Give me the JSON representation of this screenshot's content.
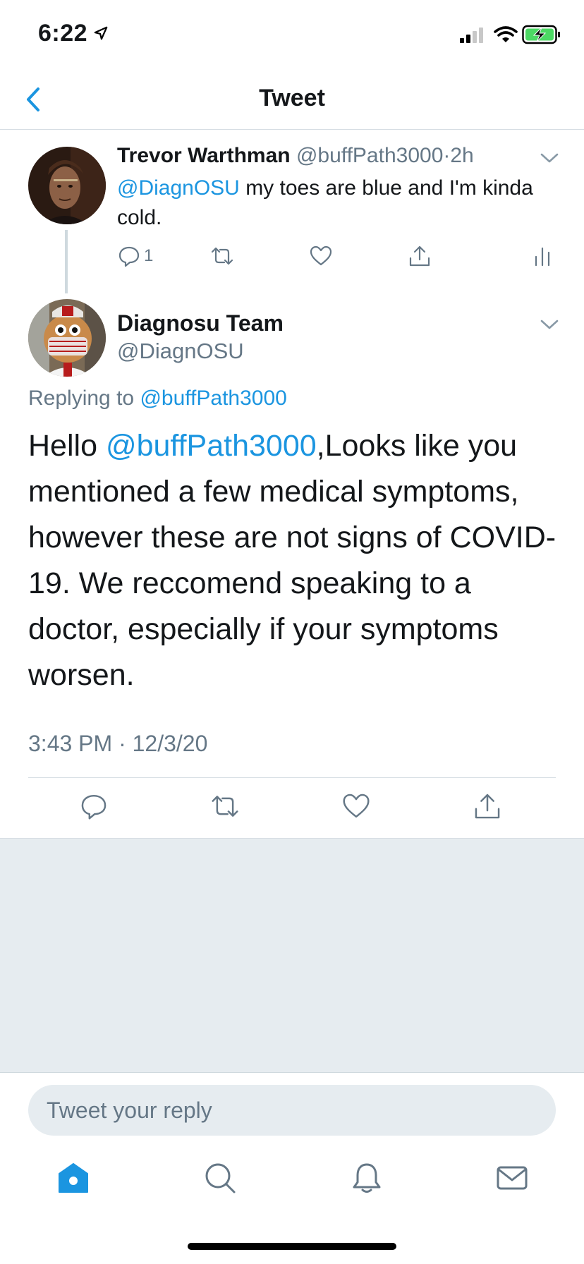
{
  "status_bar": {
    "time": "6:22",
    "icons": [
      "location-arrow-icon",
      "signal-icon",
      "wifi-icon",
      "battery-charging-icon"
    ]
  },
  "header": {
    "title": "Tweet",
    "back_icon": "chevron-left-icon"
  },
  "reply_tweet": {
    "display_name": "Trevor Warthman",
    "handle": "@buffPath3000",
    "separator": "·",
    "time_ago": "2h",
    "mention": "@DiagnOSU",
    "text": " my toes are blue and I'm kinda cold.",
    "reply_count": "1"
  },
  "main_tweet": {
    "display_name": "Diagnosu Team",
    "handle": "@DiagnOSU",
    "replying_prefix": "Replying to ",
    "replying_to": "@buffPath3000",
    "text_prefix": "Hello ",
    "text_mention": "@buffPath3000",
    "text_body": ",Looks like you mentioned a few medical symptoms, however these are not signs of COVID-19. We reccomend speaking to a doctor, especially if your symptoms worsen.",
    "timestamp": "3:43 PM · 12/3/20"
  },
  "reply_box": {
    "placeholder": "Tweet your reply"
  },
  "tab_bar": {
    "items": [
      "home-icon",
      "search-icon",
      "notifications-icon",
      "messages-icon"
    ]
  },
  "colors": {
    "accent": "#1b95e0",
    "text": "#14171a",
    "muted": "#657786",
    "border": "#d6dde3",
    "gray_bg": "#e6ecf0",
    "battery_green": "#4cd964"
  }
}
